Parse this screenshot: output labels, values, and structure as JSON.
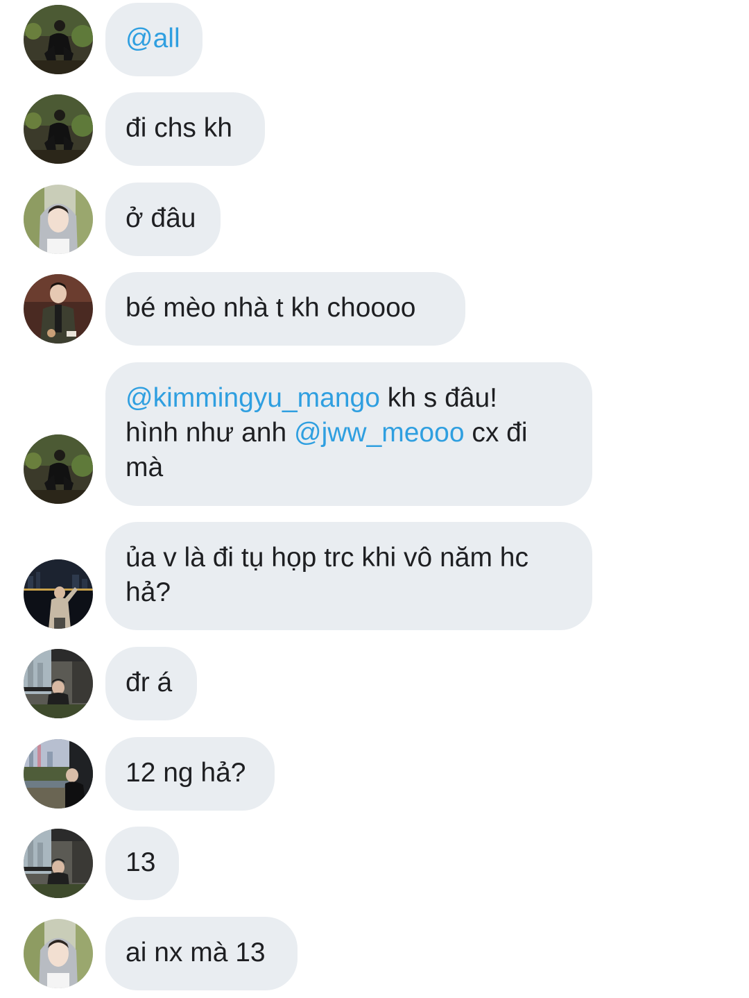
{
  "colors": {
    "bubble_bg": "#e9edf1",
    "text": "#1e1f22",
    "mention": "#2f9fe0",
    "background": "#ffffff"
  },
  "messages": [
    {
      "avatar": "night-street-boy-avatar",
      "parts": [
        {
          "text": "@all",
          "mention": true
        }
      ]
    },
    {
      "avatar": "night-street-boy-avatar",
      "parts": [
        {
          "text": "đi chs kh",
          "mention": false
        }
      ]
    },
    {
      "avatar": "grey-hoodie-avatar",
      "parts": [
        {
          "text": "ở đâu",
          "mention": false
        }
      ]
    },
    {
      "avatar": "cafe-jacket-avatar",
      "parts": [
        {
          "text": "bé mèo nhà t kh choooo",
          "mention": false
        }
      ]
    },
    {
      "avatar": "night-street-boy-avatar",
      "parts": [
        {
          "text": "@kimmingyu_mango",
          "mention": true
        },
        {
          "text": " kh s đâu!\nhình như anh ",
          "mention": false
        },
        {
          "text": "@jww_meooo",
          "mention": true
        },
        {
          "text": " cx đi\nmà",
          "mention": false
        }
      ]
    },
    {
      "avatar": "night-city-avatar",
      "parts": [
        {
          "text": "ủa v là đi tụ họp trc khi vô năm hc\nhả?",
          "mention": false
        }
      ]
    },
    {
      "avatar": "balcony-avatar",
      "parts": [
        {
          "text": "đr á",
          "mention": false
        }
      ]
    },
    {
      "avatar": "city-view-avatar",
      "parts": [
        {
          "text": "12 ng hả?",
          "mention": false
        }
      ]
    },
    {
      "avatar": "balcony-avatar",
      "parts": [
        {
          "text": "13",
          "mention": false
        }
      ]
    },
    {
      "avatar": "grey-hoodie-avatar",
      "parts": [
        {
          "text": "ai nx mà 13",
          "mention": false
        }
      ]
    }
  ]
}
